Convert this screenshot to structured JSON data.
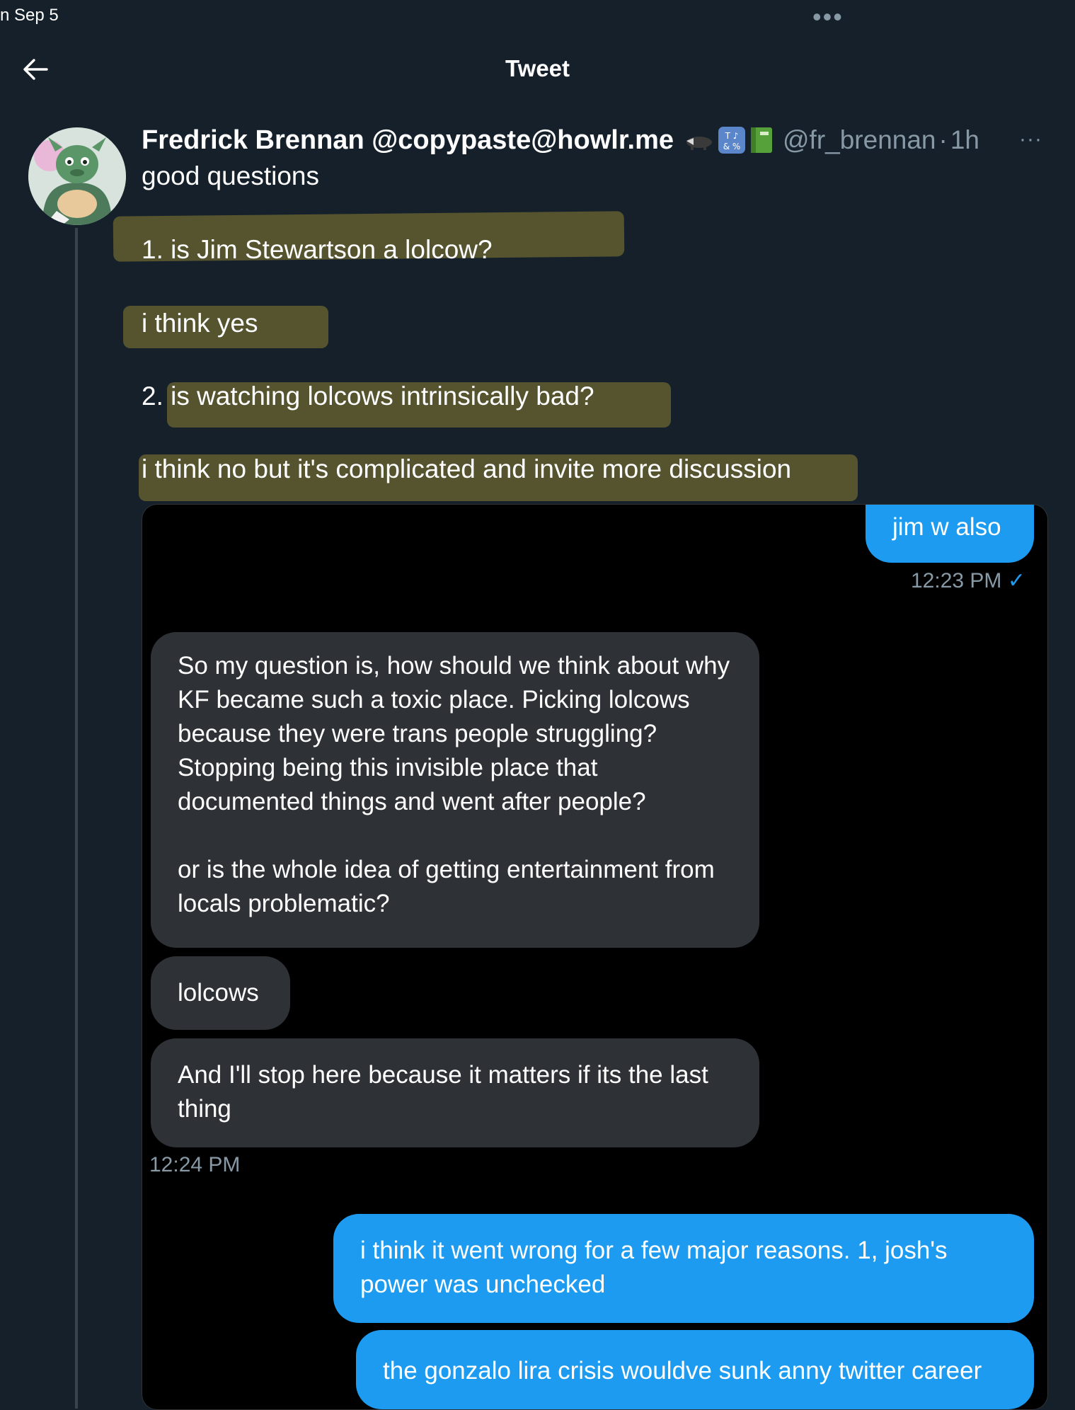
{
  "status_bar": {
    "date": "n Sep 5",
    "menu": "•••"
  },
  "header": {
    "title": "Tweet"
  },
  "tweet": {
    "author": {
      "display_name": "Fredrick Brennan @copypaste@howlr.me",
      "badges": [
        "badger-emoji",
        "symbols-emoji",
        "green-book-emoji"
      ],
      "handle": "@fr_brennan",
      "separator": "·",
      "time": "1h"
    },
    "more": "···",
    "lines": [
      "good questions",
      "1. is Jim Stewartson a lolcow?",
      "i think yes",
      "2. is watching lolcows intrinsically bad?",
      "i think no but it's complicated and invite more discussion"
    ]
  },
  "dm": {
    "messages": [
      {
        "dir": "out",
        "text": "jim w also"
      },
      {
        "dir": "time",
        "text": "12:23 PM",
        "read": "✓"
      },
      {
        "dir": "in",
        "paragraphs": [
          "So my question is, how should we think about why KF became such a toxic place. Picking lolcows because they were trans people struggling? Stopping being this invisible place that documented things and went after people?",
          "or is the whole idea of getting entertainment from locals problematic?"
        ]
      },
      {
        "dir": "in",
        "text": "lolcows"
      },
      {
        "dir": "in",
        "text": "And I'll stop here because it matters if its the last thing"
      },
      {
        "dir": "time",
        "text": "12:24 PM"
      },
      {
        "dir": "out",
        "text": "i think it went wrong for a few major reasons. 1, josh's power was unchecked"
      },
      {
        "dir": "out",
        "text": "the gonzalo lira crisis wouldve sunk anny twitter career"
      }
    ]
  },
  "colors": {
    "background": "#15202b",
    "secondary_text": "#8899a6",
    "accent": "#1d9bf0",
    "highlight": "#6b6531",
    "incoming_bubble": "#2e3236"
  }
}
